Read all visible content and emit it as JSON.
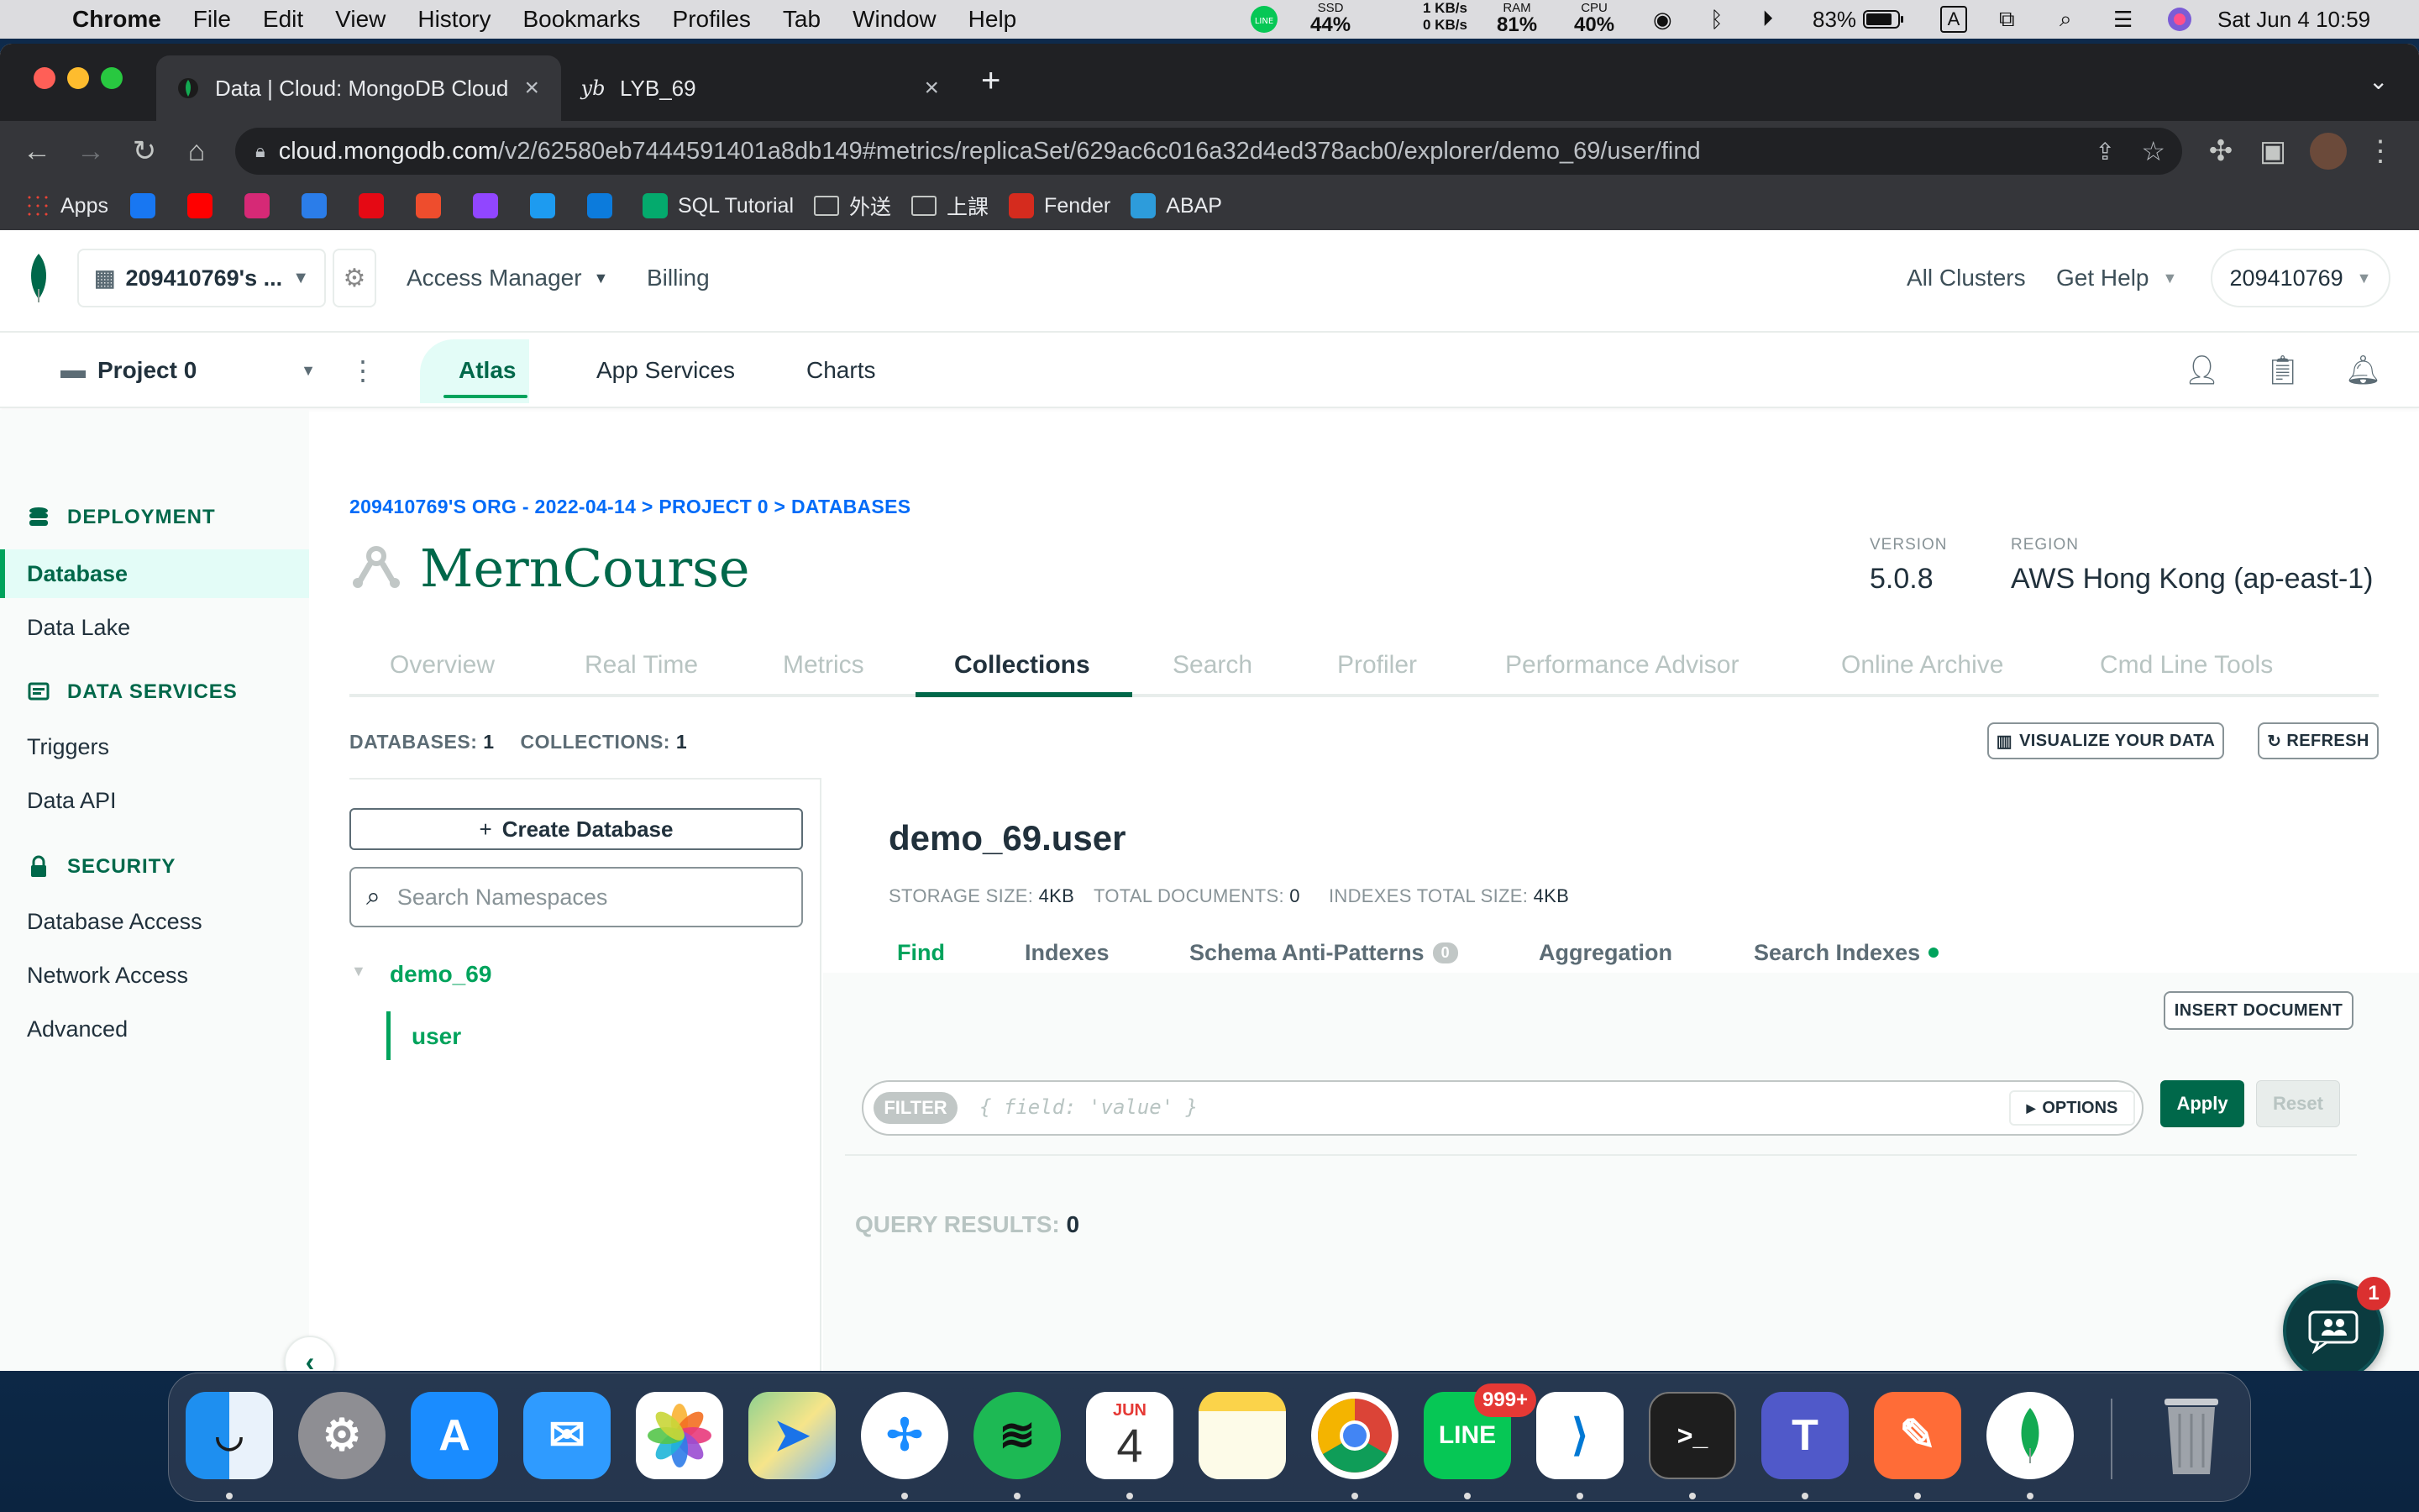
{
  "menubar": {
    "app": "Chrome",
    "items": [
      "File",
      "Edit",
      "View",
      "History",
      "Bookmarks",
      "Profiles",
      "Tab",
      "Window",
      "Help"
    ],
    "ssd_label": "SSD",
    "ssd_value": "44%",
    "net_up": "1 KB/s",
    "net_down": "0 KB/s",
    "ram_label": "RAM",
    "ram_value": "81%",
    "cpu_label": "CPU",
    "cpu_value": "40%",
    "battery": "83%",
    "input_source": "A",
    "datetime": "Sat Jun 4  10:59"
  },
  "browser": {
    "tabs": [
      {
        "title": "Data | Cloud: MongoDB Cloud",
        "active": true
      },
      {
        "title": "LYB_69",
        "active": false
      }
    ],
    "url_host": "cloud.mongodb.com",
    "url_path": "/v2/62580eb7444591401a8db149#metrics/replicaSet/629ac6c016a32d4ed378acb0/explorer/demo_69/user/find",
    "bookmarks": [
      {
        "label": "Apps",
        "color": "#ea4335"
      },
      {
        "label": "",
        "color": "#1877f2"
      },
      {
        "label": "",
        "color": "#ff0000"
      },
      {
        "label": "",
        "color": "#d62976"
      },
      {
        "label": "",
        "color": "#2b7de9"
      },
      {
        "label": "",
        "color": "#e50914"
      },
      {
        "label": "",
        "color": "#ee4d2d"
      },
      {
        "label": "",
        "color": "#9146ff"
      },
      {
        "label": "",
        "color": "#1d9bf0"
      },
      {
        "label": "",
        "color": "#0c7bdc"
      },
      {
        "label": "SQL Tutorial",
        "color": "#04aa6d"
      },
      {
        "label": "外送",
        "color": "folder"
      },
      {
        "label": "上課",
        "color": "folder"
      },
      {
        "label": "Fender",
        "color": "#d52b1e"
      },
      {
        "label": "ABAP",
        "color": "#2d9cdb"
      }
    ]
  },
  "atlas": {
    "org": "209410769's ...",
    "nav": [
      "Access Manager",
      "Billing"
    ],
    "right_nav": [
      "All Clusters",
      "Get Help"
    ],
    "user": "209410769",
    "project": "Project 0",
    "project_tabs": [
      "Atlas",
      "App Services",
      "Charts"
    ]
  },
  "sidebar": {
    "sections": [
      {
        "title": "DEPLOYMENT",
        "items": [
          "Database",
          "Data Lake"
        ]
      },
      {
        "title": "DATA SERVICES",
        "items": [
          "Triggers",
          "Data API"
        ]
      },
      {
        "title": "SECURITY",
        "items": [
          "Database Access",
          "Network Access",
          "Advanced"
        ]
      }
    ],
    "active": "Database"
  },
  "cluster": {
    "breadcrumb": "209410769'S ORG - 2022-04-14 > PROJECT 0 > DATABASES",
    "name": "MernCourse",
    "version_label": "VERSION",
    "version": "5.0.8",
    "region_label": "REGION",
    "region": "AWS Hong Kong (ap-east-1)",
    "tabs": [
      "Overview",
      "Real Time",
      "Metrics",
      "Collections",
      "Search",
      "Profiler",
      "Performance Advisor",
      "Online Archive",
      "Cmd Line Tools"
    ],
    "active_tab": "Collections"
  },
  "collections": {
    "databases_label": "DATABASES:",
    "databases_count": "1",
    "collections_label": "COLLECTIONS:",
    "collections_count": "1",
    "visualize_btn": "VISUALIZE YOUR DATA",
    "refresh_btn": "REFRESH",
    "create_db": "Create Database",
    "search_placeholder": "Search Namespaces",
    "database": "demo_69",
    "collection": "user"
  },
  "namespace": {
    "title": "demo_69.user",
    "storage_label": "STORAGE SIZE:",
    "storage": "4KB",
    "docs_label": "TOTAL DOCUMENTS:",
    "docs": "0",
    "indexes_label": "INDEXES TOTAL SIZE:",
    "indexes": "4KB",
    "subtabs": [
      "Find",
      "Indexes",
      "Schema Anti-Patterns",
      "Aggregation",
      "Search Indexes"
    ],
    "anti_patterns_count": "0",
    "insert_btn": "INSERT DOCUMENT",
    "filter_label": "FILTER",
    "filter_placeholder": "{ field: 'value' }",
    "options_btn": "OPTIONS",
    "apply_btn": "Apply",
    "reset_btn": "Reset",
    "results_label": "QUERY RESULTS:",
    "results_count": "0"
  },
  "chat_badge": "1",
  "dock": {
    "calendar_month": "JUN",
    "calendar_day": "4",
    "line_badge": "999+"
  }
}
